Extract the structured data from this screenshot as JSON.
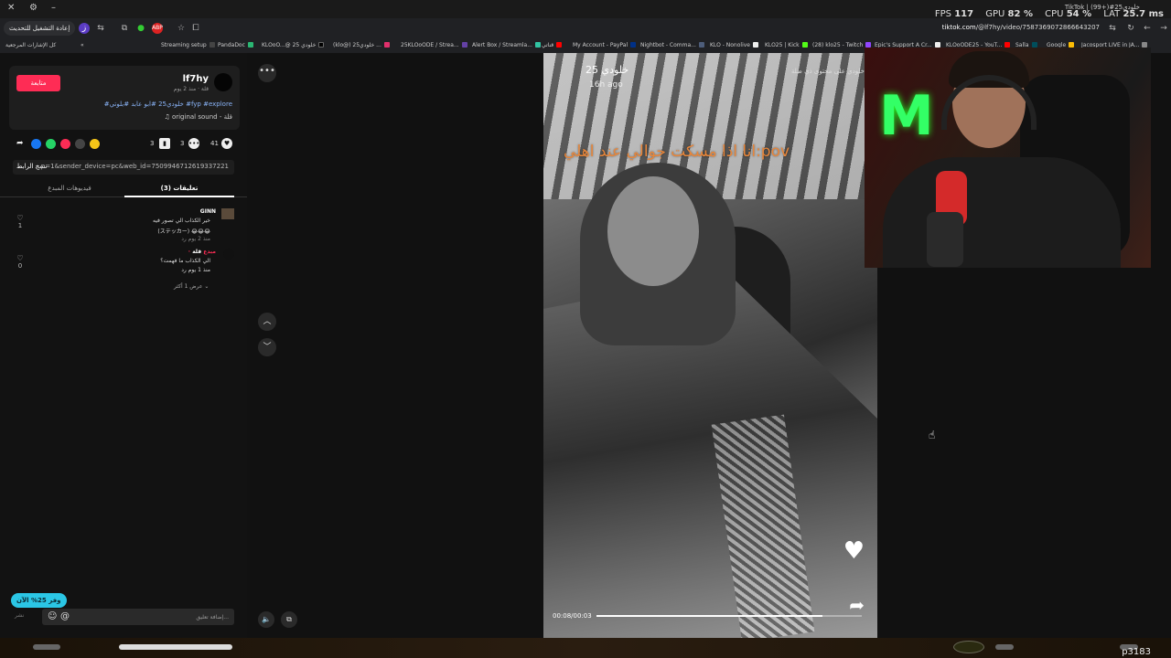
{
  "titlebar": {
    "tab_title": "TikTok | (99+)#خلودي25",
    "stats": {
      "fps_label": "FPS",
      "fps": "117",
      "gpu_label": "GPU",
      "gpu": "82 %",
      "cpu_label": "CPU",
      "cpu": "54 %",
      "lat_label": "LAT",
      "lat": "25.7 ms"
    }
  },
  "toolbar": {
    "update_label": "إعادة التشغيل للتحديث",
    "url_host": "tiktok.com",
    "url_path": "/@lf7hy/video/7587369072866643207"
  },
  "bookmarks": [
    {
      "label": "كل الإشارات المرجعية",
      "color": "#666"
    },
    {
      "label": "Streaming setup",
      "color": "#333"
    },
    {
      "label": "PandaDoc",
      "color": "#2bb673"
    },
    {
      "label": "KLOoO...@ خلودي 25",
      "color": "#000"
    },
    {
      "label": "(klo@) خلودي25 ...",
      "color": "#e1306c"
    },
    {
      "label": "25KLOoODE / Strea...",
      "color": "#6441a5"
    },
    {
      "label": "Alert Box / Streamla...",
      "color": "#31c3a2"
    },
    {
      "label": "قناتي",
      "color": "#ff0000"
    },
    {
      "label": "My Account - PayPal",
      "color": "#003087"
    },
    {
      "label": "Nightbot - Comma...",
      "color": "#4d5d7a"
    },
    {
      "label": "KLO - Nonolive",
      "color": "#eee"
    },
    {
      "label": "KLO25 | Kick",
      "color": "#53fc18"
    },
    {
      "label": "(28) klo25 - Twitch",
      "color": "#9146ff"
    },
    {
      "label": "Epic's Support A Cr...",
      "color": "#eee"
    },
    {
      "label": "KLOoODE25 - YouT...",
      "color": "#ff0000"
    },
    {
      "label": "Salla",
      "color": "#004d5a"
    },
    {
      "label": "Google",
      "color": "#fbbc05"
    },
    {
      "label": "Jacosport LIVE in JA...",
      "color": "#888"
    }
  ],
  "post": {
    "follow_label": "متابعة",
    "username": "lf7hy",
    "meta": "قلة · منذ 2 يوم",
    "tags": "#خلودي25 #ابو عابد #بلوتي #fyp #explore",
    "sound": "original sound - قلة",
    "likes": "41",
    "comments": "3",
    "saves": "3",
    "copy_link_label": "نسخ الرابط",
    "link": "...p=1&sender_device=pc&web_id=7509946712619337221",
    "tab_comments": "تعليقات (3)",
    "tab_creator_videos": "فيديوهات المبدع"
  },
  "comments": [
    {
      "name": "GINN",
      "line1": "خير الكذاب الي تصور فيه",
      "line2": "(ステッカー) 😂😂😂",
      "meta": "منذ 2 يوم   رد",
      "likes": "1"
    },
    {
      "name": "قلة",
      "creator_tag": "· مبدع",
      "line1": "الي الكذاب ما فهمت؟",
      "meta": "منذ 1 يوم   رد",
      "likes": "0"
    }
  ],
  "more_replies": "عرض 1 أكثر",
  "video": {
    "author": "خلودي 25",
    "time_ago": "16h ago",
    "note": "خلودي على محتوى ذي صلة",
    "caption": "انا اذا مسكت جوالي عند اهلي:pov",
    "timecode": "00:08/00:03",
    "progress": 0.85
  },
  "promo_badge": "وفر 25% الآن",
  "comment_input": {
    "placeholder": "إضافة تعليق...",
    "post_label": "نشر"
  },
  "stream_label": "p3183"
}
